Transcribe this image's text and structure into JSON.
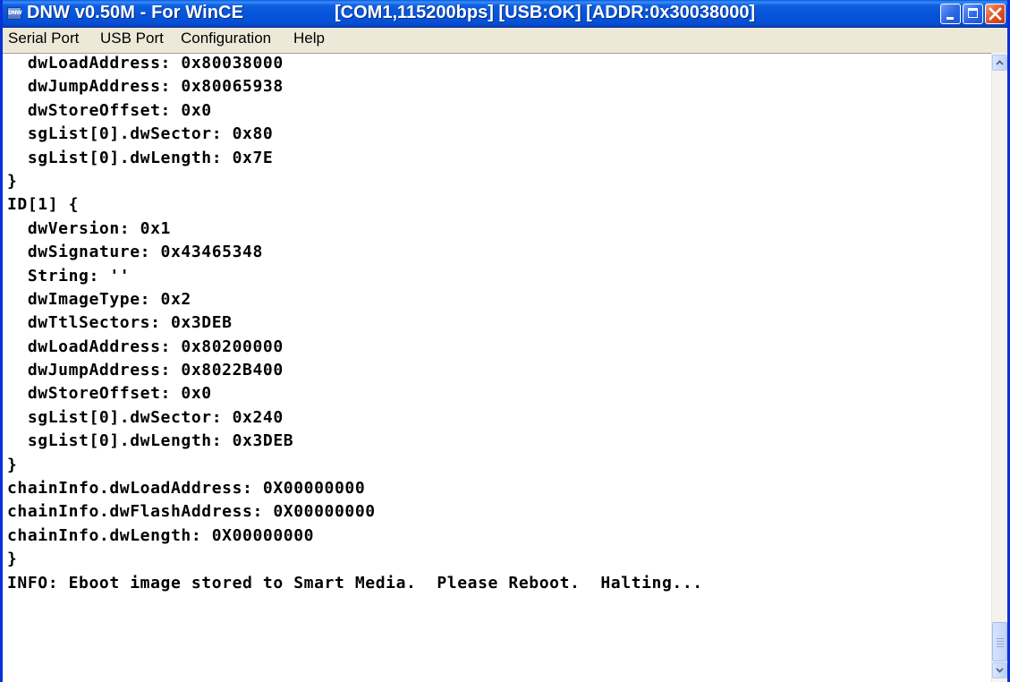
{
  "window": {
    "icon_label": "DNW",
    "title": "DNW v0.50M - For WinCE",
    "status": "[COM1,115200bps] [USB:OK] [ADDR:0x30038000]"
  },
  "menu": {
    "items": [
      "Serial Port",
      "USB Port",
      "Configuration",
      "Help"
    ]
  },
  "console": {
    "lines": [
      "  dwLoadAddress: 0x80038000",
      "  dwJumpAddress: 0x80065938",
      "  dwStoreOffset: 0x0",
      "  sgList[0].dwSector: 0x80",
      "  sgList[0].dwLength: 0x7E",
      "}",
      "ID[1] {",
      "  dwVersion: 0x1",
      "  dwSignature: 0x43465348",
      "  String: ''",
      "  dwImageType: 0x2",
      "  dwTtlSectors: 0x3DEB",
      "  dwLoadAddress: 0x80200000",
      "  dwJumpAddress: 0x8022B400",
      "  dwStoreOffset: 0x0",
      "  sgList[0].dwSector: 0x240",
      "  sgList[0].dwLength: 0x3DEB",
      "}",
      "chainInfo.dwLoadAddress: 0X00000000",
      "chainInfo.dwFlashAddress: 0X00000000",
      "chainInfo.dwLength: 0X00000000",
      "}",
      "INFO: Eboot image stored to Smart Media.  Please Reboot.  Halting...",
      ""
    ]
  },
  "scrollbar": {
    "position": 1.0
  }
}
